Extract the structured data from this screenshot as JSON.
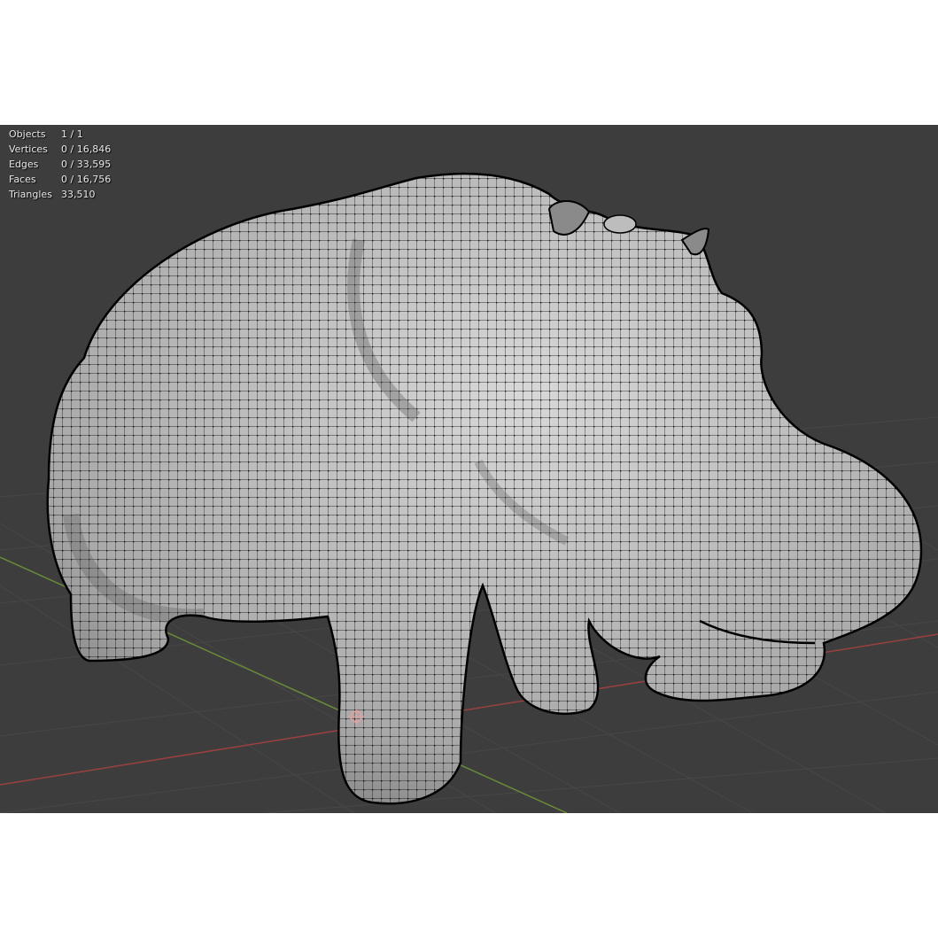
{
  "viewport": {
    "background_color": "#3d3d3d",
    "grid_color": "#474747",
    "x_axis_color": "#9a4040",
    "y_axis_color": "#6a8a3a",
    "object": "mesh-wireframe",
    "mesh_base_color": "#a9a9a9",
    "wire_color": "#111111"
  },
  "stats": {
    "objects": {
      "label": "Objects",
      "value": "1 / 1"
    },
    "vertices": {
      "label": "Vertices",
      "value": "0 / 16,846"
    },
    "edges": {
      "label": "Edges",
      "value": "0 / 33,595"
    },
    "faces": {
      "label": "Faces",
      "value": "0 / 16,756"
    },
    "triangles": {
      "label": "Triangles",
      "value": "33,510"
    }
  },
  "origin_icon": "object-origin-icon"
}
